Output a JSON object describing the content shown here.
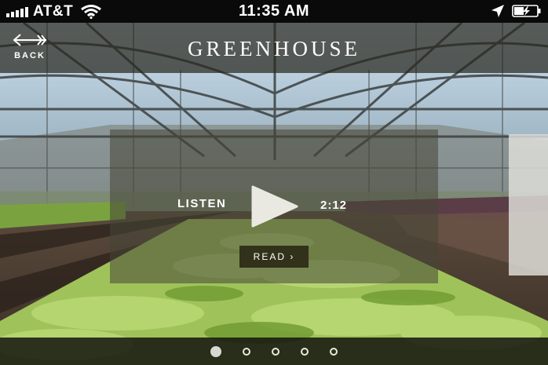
{
  "status_bar": {
    "carrier": "AT&T",
    "time": "11:35 AM",
    "icons": [
      "signal-bars-icon",
      "wifi-icon",
      "location-arrow-icon",
      "battery-charging-icon"
    ]
  },
  "header": {
    "back_label": "BACK",
    "back_icon": "arrow-left-icon",
    "title": "GREENHOUSE"
  },
  "audio": {
    "listen_label": "LISTEN",
    "play_icon": "play-icon",
    "duration": "2:12"
  },
  "read_button": {
    "label": "READ ›"
  },
  "pager": {
    "count": 5,
    "active_index": 0
  },
  "colors": {
    "header_overlay": "#28281e",
    "read_button": "#2d2a16",
    "plants": "#8fbf4a",
    "sky": "#c9def0"
  }
}
